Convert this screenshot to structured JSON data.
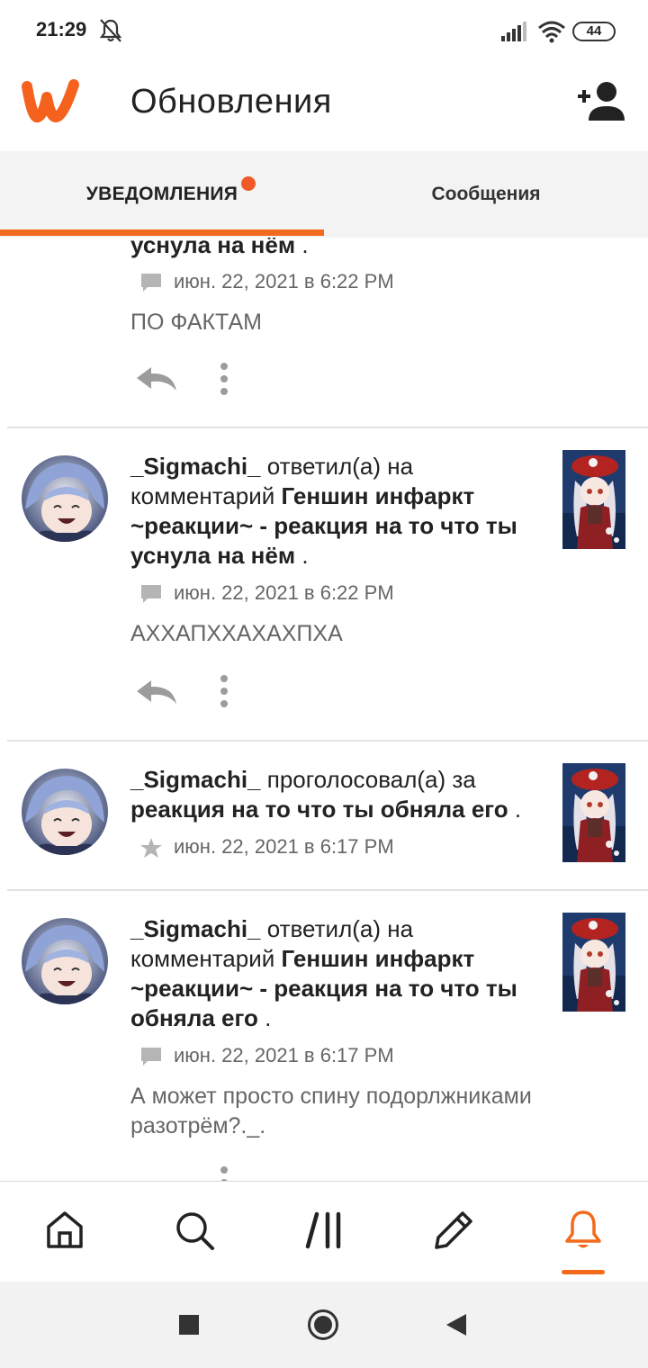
{
  "status_bar": {
    "time": "21:29",
    "battery": "44"
  },
  "header": {
    "title": "Обновления"
  },
  "tabs": [
    {
      "label": "УВЕДОМЛЕНИЯ",
      "active": true,
      "has_badge": true
    },
    {
      "label": "Сообщения",
      "active": false
    }
  ],
  "feed": {
    "partial_item": {
      "story_tail": "уснула на нём",
      "suffix": " .",
      "timestamp": "июн. 22, 2021 в 6:22 PM",
      "comment": "ПО ФАКТАМ"
    },
    "items": [
      {
        "user": "_Sigmachi_",
        "action": " ответил(а) на комментарий ",
        "story": "Геншин инфаркт ~реакции~ - реакция на то что ты уснула на нём",
        "suffix": " .",
        "meta_icon": "comment-icon",
        "timestamp": "июн. 22, 2021 в 6:22 PM",
        "comment": "АХХАПХХАХАХПХА"
      },
      {
        "user": "_Sigmachi_",
        "action": " проголосовал(а) за ",
        "story": "реакция на то что ты обняла его",
        "suffix": " .",
        "meta_icon": "star-icon",
        "timestamp": "июн. 22, 2021 в 6:17 PM",
        "comment": ""
      },
      {
        "user": "_Sigmachi_",
        "action": " ответил(а) на комментарий ",
        "story": "Геншин инфаркт ~реакции~ - реакция на то что ты обняла его",
        "suffix": " .",
        "meta_icon": "comment-icon",
        "timestamp": "июн. 22, 2021 в 6:17 PM",
        "comment": "А может просто спину подорлжниками разотрём?._."
      }
    ]
  },
  "bottom_nav": [
    {
      "icon": "home-icon",
      "active": false
    },
    {
      "icon": "search-icon",
      "active": false
    },
    {
      "icon": "library-icon",
      "active": false
    },
    {
      "icon": "write-icon",
      "active": false
    },
    {
      "icon": "notifications-bell-icon",
      "active": true
    }
  ],
  "colors": {
    "accent": "#f26a1b",
    "badge": "#f05a28",
    "tab_bar_bg": "#f4f3f4",
    "secondary_text": "#666666"
  }
}
